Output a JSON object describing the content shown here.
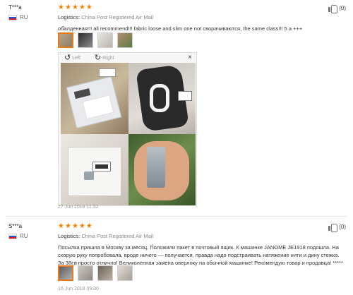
{
  "reviews": [
    {
      "user_name": "T***a",
      "country": "RU",
      "rating_stars": 5,
      "stars": [
        "★",
        "★",
        "★",
        "★",
        "★"
      ],
      "logistics_key": "Logistics:",
      "logistics_value": "China Post Registered Air Mail",
      "text": "обалденная!!! all recommend!!! fabric loose and slim one not сворачиваются, the same class!!! 5 a +++",
      "viewer": {
        "left_label": "Left",
        "right_label": "Right",
        "close": "×"
      },
      "date": "27 Jun 2018 11:32",
      "helpful_count": "(0)",
      "photo_icons": [
        "rotate-left-icon",
        "rotate-right-icon",
        "close-icon"
      ]
    },
    {
      "user_name": "S***a",
      "country": "RU",
      "rating_stars": 5,
      "stars": [
        "★",
        "★",
        "★",
        "★",
        "★"
      ],
      "logistics_key": "Logistics:",
      "logistics_value": "China Post Registered Air Mail",
      "text": "Посылка пришла в Москву за месяц. Положили пакет в почтовый ящик. К машинке JANOME JE1918 подошла. На скорую руку попробовала, вроде ничего — получается, правда надо подстраивать натяжение нити и дину стежка. За 38㎝ просто отлично! Великолепная замена оверлоку на обычной машинке! Рекомендую товар и продавца! *****",
      "date": "16 Jun 2018 09:00",
      "helpful_count": "(0)"
    }
  ],
  "colors": {
    "star": "#f08200",
    "thumb_active_border": "#e87a1c",
    "muted": "#888888"
  }
}
